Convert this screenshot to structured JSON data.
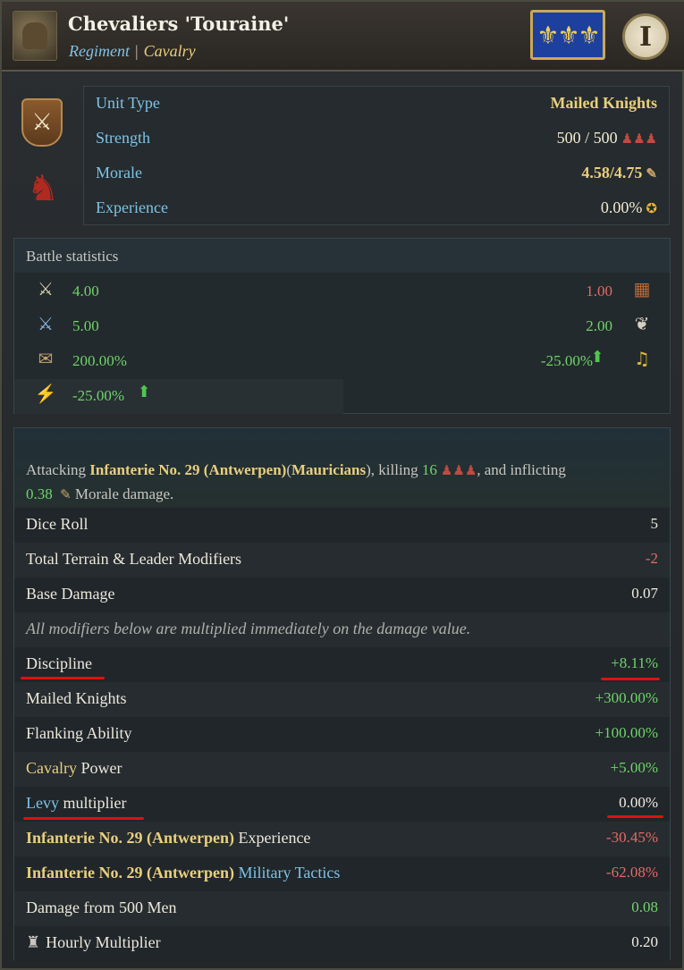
{
  "header": {
    "title": "Chevaliers 'Touraine'",
    "subtitle_regiment": "Regiment",
    "subtitle_sep": "|",
    "subtitle_type": "Cavalry",
    "flag": "⚜⚜⚜",
    "info_button": "I"
  },
  "unit": {
    "rows": [
      {
        "label": "Unit Type",
        "value": "Mailed Knights"
      },
      {
        "label": "Strength",
        "value": "500 / 500"
      },
      {
        "label": "Morale",
        "value": "4.58/4.75"
      },
      {
        "label": "Experience",
        "value": "0.00%"
      }
    ]
  },
  "battle": {
    "title": "Battle statistics",
    "left": [
      "4.00",
      "5.00",
      "200.00%",
      "-25.00%"
    ],
    "right": [
      "1.00",
      "2.00",
      "-25.00%"
    ]
  },
  "combat": {
    "desc": {
      "p1": "Attacking ",
      "target": "Infanterie No. 29 (Antwerpen)",
      "paren_open": "(",
      "faction": "Mauricians",
      "p2": "), killing ",
      "killed": "16",
      "p3": ", and inflicting",
      "morale_dmg": "0.38",
      "p4": "Morale damage."
    },
    "rows": [
      {
        "label": "Dice Roll",
        "value": "5"
      },
      {
        "label": "Total Terrain & Leader Modifiers",
        "value": "-2"
      },
      {
        "label": "Base Damage",
        "value": "0.07"
      },
      {
        "label": "All modifiers below are multiplied immediately on the damage value."
      },
      {
        "label": "Discipline",
        "value": "+8.11%"
      },
      {
        "label": "Mailed Knights",
        "value": "+300.00%"
      },
      {
        "label": "Flanking Ability",
        "value": "+100.00%"
      },
      {
        "label_a": "Cavalry",
        "label_b": " Power",
        "value": "+5.00%"
      },
      {
        "label_a": "Levy",
        "label_b": " multiplier",
        "value": "0.00%"
      },
      {
        "label_a": "Infanterie No. 29 (Antwerpen)",
        "label_b": " Experience",
        "value": "-30.45%"
      },
      {
        "label_a": "Infanterie No. 29 (Antwerpen)",
        "label_b": "Military Tactics",
        "value": "-62.08%"
      },
      {
        "label": "Damage from 500 Men",
        "value": "0.08"
      },
      {
        "label": "Hourly Multiplier",
        "value": "0.20"
      }
    ]
  },
  "colors": {
    "accent_blue": "#7ec3e6",
    "accent_gold": "#e9cf7d",
    "positive": "#6fd46b",
    "negative": "#e46a66",
    "annotation_red": "#e01010"
  },
  "icons": [
    "soldier-portrait-icon",
    "fleur-de-lis-flag-icon",
    "info-icon",
    "crossed-swords-shield-icon",
    "knight-rider-icon",
    "soldiers-icon",
    "morale-scroll-icon",
    "experience-medal-icon",
    "attack-icon",
    "flank-icon",
    "bricks-icon",
    "wing-boot-icon",
    "trumpet-icon",
    "lightning-icon",
    "arrow-up-icon"
  ]
}
